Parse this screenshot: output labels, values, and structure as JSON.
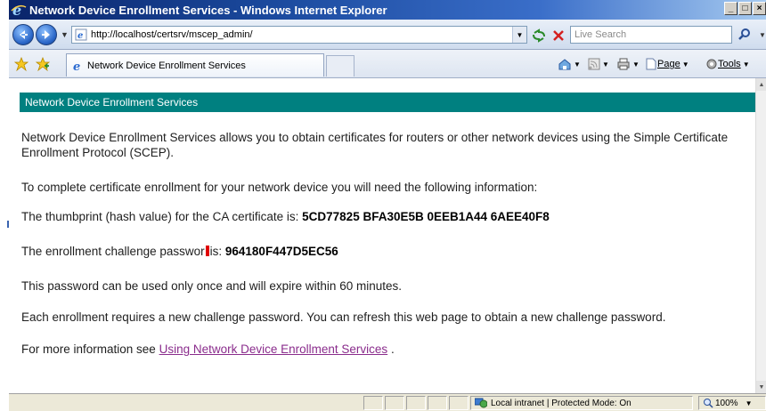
{
  "window": {
    "title": "Network Device Enrollment Services - Windows Internet Explorer",
    "buttons": {
      "minimize": "_",
      "maximize": "□",
      "close": "×"
    }
  },
  "toolbar": {
    "address": "http://localhost/certsrv/mscep_admin/",
    "search_placeholder": "Live Search",
    "page_label": "Page",
    "tools_label": "Tools"
  },
  "tab": {
    "title": "Network Device Enrollment Services"
  },
  "page": {
    "banner": "Network Device Enrollment Services",
    "intro": "Network Device Enrollment Services allows you to obtain certificates for routers or other network devices using the Simple Certificate Enrollment Protocol (SCEP).",
    "complete": "To complete certificate enrollment for your network device you will need the following information:",
    "thumbprint_label": "The thumbprint (hash value) for the CA certificate is:",
    "thumbprint_value": "5CD77825 BFA30E5B 0EEB1A44 6AEE40F8",
    "password_label_a": "The enrollment challenge passwor",
    "password_label_b": "is:",
    "password_value": "964180F447D5EC56",
    "once": "This password can be used only once and will expire within 60 minutes.",
    "each": "Each enrollment requires a new challenge password. You can refresh this web page to obtain a new challenge password.",
    "more_prefix": "For more information see",
    "more_link": "Using Network Device Enrollment Services",
    "more_suffix": "."
  },
  "status": {
    "zone": "Local intranet | Protected Mode: On",
    "zoom": "100%"
  },
  "colors": {
    "banner": "#008080",
    "link": "#8a2c8c",
    "titlebar": "#0a246a"
  }
}
